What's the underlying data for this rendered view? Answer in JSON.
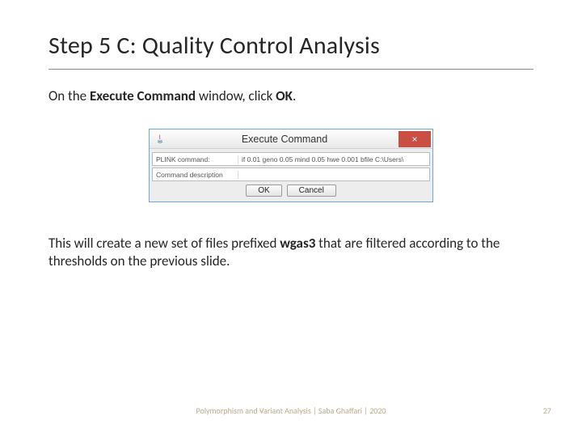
{
  "title": "Step 5 C: Quality Control Analysis",
  "intro": {
    "pre": "On the ",
    "bold1": "Execute Command",
    "mid": " window, click ",
    "bold2": "OK",
    "post": "."
  },
  "dialog": {
    "title": "Execute Command",
    "close_symbol": "×",
    "row1": {
      "label": "PLINK command:",
      "value": "if 0.01  geno 0.05  mind 0.05  hwe 0.001  bfile C:\\Users\\"
    },
    "row2": {
      "label": "Command description",
      "value": ""
    },
    "ok_label": "OK",
    "cancel_label": "Cancel"
  },
  "outro": {
    "pre": "This will create a new set of files prefixed ",
    "bold": "wgas3",
    "post": " that are filtered according to the thresholds on the previous slide."
  },
  "footer": "Polymorphism and Variant Analysis | Saba Ghaffari | 2020",
  "page": "27"
}
